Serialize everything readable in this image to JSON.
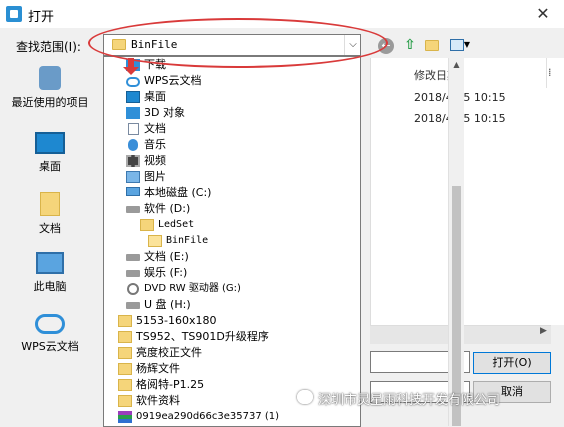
{
  "window": {
    "title": "打开",
    "close_glyph": "✕"
  },
  "lookin": {
    "label": "查找范围(I):",
    "value": "BinFile"
  },
  "places": [
    {
      "label": "最近使用的项目",
      "icon": "recent-places-icon"
    },
    {
      "label": "桌面",
      "icon": "desktop-icon"
    },
    {
      "label": "文档",
      "icon": "documents-icon"
    },
    {
      "label": "此电脑",
      "icon": "this-pc-icon"
    },
    {
      "label": "WPS云文档",
      "icon": "wps-cloud-icon"
    }
  ],
  "file_list": {
    "column_modified": "修改日期",
    "rows": [
      {
        "date": "2018/4/25 10:15"
      },
      {
        "date": "2018/4/25 10:15"
      }
    ]
  },
  "dropdown_items": [
    {
      "label": "下载",
      "icon": "download-icon"
    },
    {
      "label": "WPS云文档",
      "icon": "cloud-icon"
    },
    {
      "label": "桌面",
      "icon": "desktop-icon"
    },
    {
      "label": "3D 对象",
      "icon": "3d-objects-icon"
    },
    {
      "label": "文档",
      "icon": "document-icon"
    },
    {
      "label": "音乐",
      "icon": "music-icon"
    },
    {
      "label": "视频",
      "icon": "video-icon"
    },
    {
      "label": "图片",
      "icon": "pictures-icon"
    },
    {
      "label": "本地磁盘 (C:)",
      "icon": "drive-icon"
    },
    {
      "label": "软件 (D:)",
      "icon": "drive-icon"
    },
    {
      "label": "LedSet",
      "icon": "folder-icon"
    },
    {
      "label": "BinFile",
      "icon": "folder-open-icon"
    },
    {
      "label": "文档 (E:)",
      "icon": "drive-icon"
    },
    {
      "label": "娱乐 (F:)",
      "icon": "drive-icon"
    },
    {
      "label": "DVD RW 驱动器 (G:)",
      "icon": "dvd-drive-icon"
    },
    {
      "label": "U 盘 (H:)",
      "icon": "usb-drive-icon"
    },
    {
      "label": "5153-160x180",
      "icon": "folder-icon"
    },
    {
      "label": "TS952、TS901D升级程序",
      "icon": "folder-icon"
    },
    {
      "label": "亮度校正文件",
      "icon": "folder-icon"
    },
    {
      "label": "杨辉文件",
      "icon": "folder-icon"
    },
    {
      "label": "格阅特-P1.25",
      "icon": "folder-icon"
    },
    {
      "label": "软件资料",
      "icon": "folder-icon"
    },
    {
      "label": "0919ea290d66c3e35737 (1)",
      "icon": "archive-icon"
    }
  ],
  "buttons": {
    "open": "打开(O)",
    "cancel": "取消"
  },
  "watermark": {
    "text": "深圳市灵星雨科技开发有限公司"
  },
  "colors": {
    "annotation": "#d93a3a",
    "accent": "#0078d7"
  }
}
